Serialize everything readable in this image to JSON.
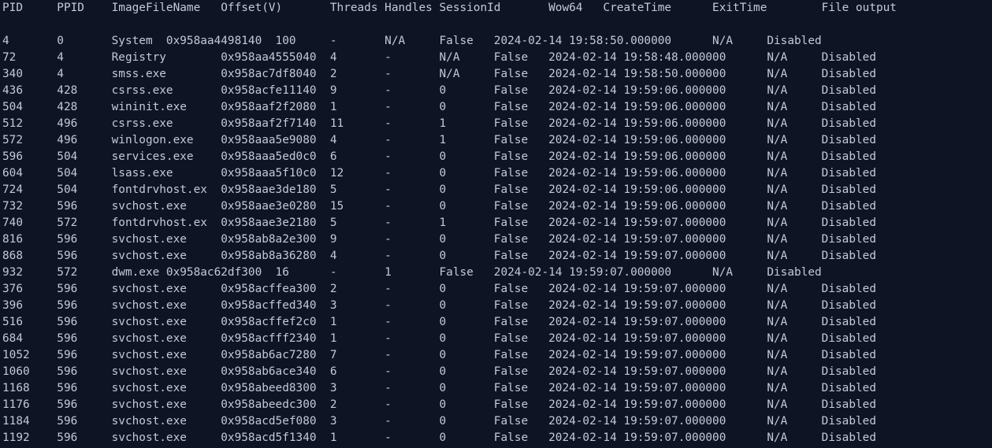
{
  "terminal": {
    "header": "PID     PPID    ImageFileName   Offset(V)       Threads Handles SessionId       Wow64   CreateTime      ExitTime        File output",
    "lines": [
      "4       0       System  0x958aa4498140  100     -       N/A     False   2024-02-14 19:58:50.000000      N/A     Disabled",
      "72      4       Registry        0x958aa4555040  4       -       N/A     False   2024-02-14 19:58:48.000000      N/A     Disabled",
      "340     4       smss.exe        0x958ac7df8040  2       -       N/A     False   2024-02-14 19:58:50.000000      N/A     Disabled",
      "436     428     csrss.exe       0x958acfe11140  9       -       0       False   2024-02-14 19:59:06.000000      N/A     Disabled",
      "504     428     wininit.exe     0x958aaf2f2080  1       -       0       False   2024-02-14 19:59:06.000000      N/A     Disabled",
      "512     496     csrss.exe       0x958aaf2f7140  11      -       1       False   2024-02-14 19:59:06.000000      N/A     Disabled",
      "572     496     winlogon.exe    0x958aaa5e9080  4       -       1       False   2024-02-14 19:59:06.000000      N/A     Disabled",
      "596     504     services.exe    0x958aaa5ed0c0  6       -       0       False   2024-02-14 19:59:06.000000      N/A     Disabled",
      "604     504     lsass.exe       0x958aaa5f10c0  12      -       0       False   2024-02-14 19:59:06.000000      N/A     Disabled",
      "724     504     fontdrvhost.ex  0x958aae3de180  5       -       0       False   2024-02-14 19:59:06.000000      N/A     Disabled",
      "732     596     svchost.exe     0x958aae3e0280  15      -       0       False   2024-02-14 19:59:06.000000      N/A     Disabled",
      "740     572     fontdrvhost.ex  0x958aae3e2180  5       -       1       False   2024-02-14 19:59:07.000000      N/A     Disabled",
      "816     596     svchost.exe     0x958ab8a2e300  9       -       0       False   2024-02-14 19:59:07.000000      N/A     Disabled",
      "868     596     svchost.exe     0x958ab8a36280  4       -       0       False   2024-02-14 19:59:07.000000      N/A     Disabled",
      "932     572     dwm.exe 0x958ac62df300  16      -       1       False   2024-02-14 19:59:07.000000      N/A     Disabled",
      "376     596     svchost.exe     0x958acffea300  2       -       0       False   2024-02-14 19:59:07.000000      N/A     Disabled",
      "396     596     svchost.exe     0x958acffed340  3       -       0       False   2024-02-14 19:59:07.000000      N/A     Disabled",
      "516     596     svchost.exe     0x958acffef2c0  1       -       0       False   2024-02-14 19:59:07.000000      N/A     Disabled",
      "684     596     svchost.exe     0x958acfff2340  1       -       0       False   2024-02-14 19:59:07.000000      N/A     Disabled",
      "1052    596     svchost.exe     0x958ab6ac7280  7       -       0       False   2024-02-14 19:59:07.000000      N/A     Disabled",
      "1060    596     svchost.exe     0x958ab6ace340  6       -       0       False   2024-02-14 19:59:07.000000      N/A     Disabled",
      "1168    596     svchost.exe     0x958abeed8300  3       -       0       False   2024-02-14 19:59:07.000000      N/A     Disabled",
      "1176    596     svchost.exe     0x958abeedc300  2       -       0       False   2024-02-14 19:59:07.000000      N/A     Disabled",
      "1184    596     svchost.exe     0x958acd5ef080  3       -       0       False   2024-02-14 19:59:07.000000      N/A     Disabled",
      "1192    596     svchost.exe     0x958acd5f1340  1       -       0       False   2024-02-14 19:59:07.000000      N/A     Disabled"
    ]
  }
}
